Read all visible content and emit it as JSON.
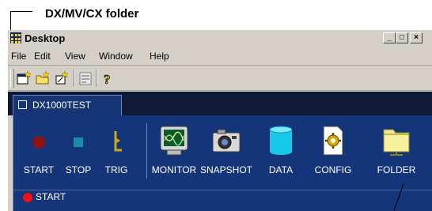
{
  "callout": {
    "label": "DX/MV/CX folder"
  },
  "window": {
    "title": "Desktop",
    "controls": {
      "minimize": "_",
      "maximize": "□",
      "close": "×"
    }
  },
  "menubar": {
    "items": [
      "File",
      "Edit",
      "View",
      "Window",
      "Help"
    ]
  },
  "toolbar": {
    "buttons": [
      "new-window-icon",
      "new-folder-icon",
      "new-item-icon",
      "properties-icon",
      "help-icon"
    ]
  },
  "tab": {
    "label": "DX1000TEST"
  },
  "tools": [
    {
      "label": "START",
      "icon": "start-icon"
    },
    {
      "label": "STOP",
      "icon": "stop-icon"
    },
    {
      "label": "TRIG",
      "icon": "trig-icon"
    },
    {
      "label": "MONITOR",
      "icon": "monitor-icon"
    },
    {
      "label": "SNAPSHOT",
      "icon": "camera-icon"
    },
    {
      "label": "DATA",
      "icon": "data-cylinder-icon"
    },
    {
      "label": "CONFIG",
      "icon": "config-icon"
    },
    {
      "label": "FOLDER",
      "icon": "folder-icon"
    }
  ],
  "status": {
    "text": "START",
    "color": "#ee1111"
  },
  "colors": {
    "panel": "#15357a",
    "tabstrip": "#101a36",
    "chrome": "#d4d0c8"
  }
}
